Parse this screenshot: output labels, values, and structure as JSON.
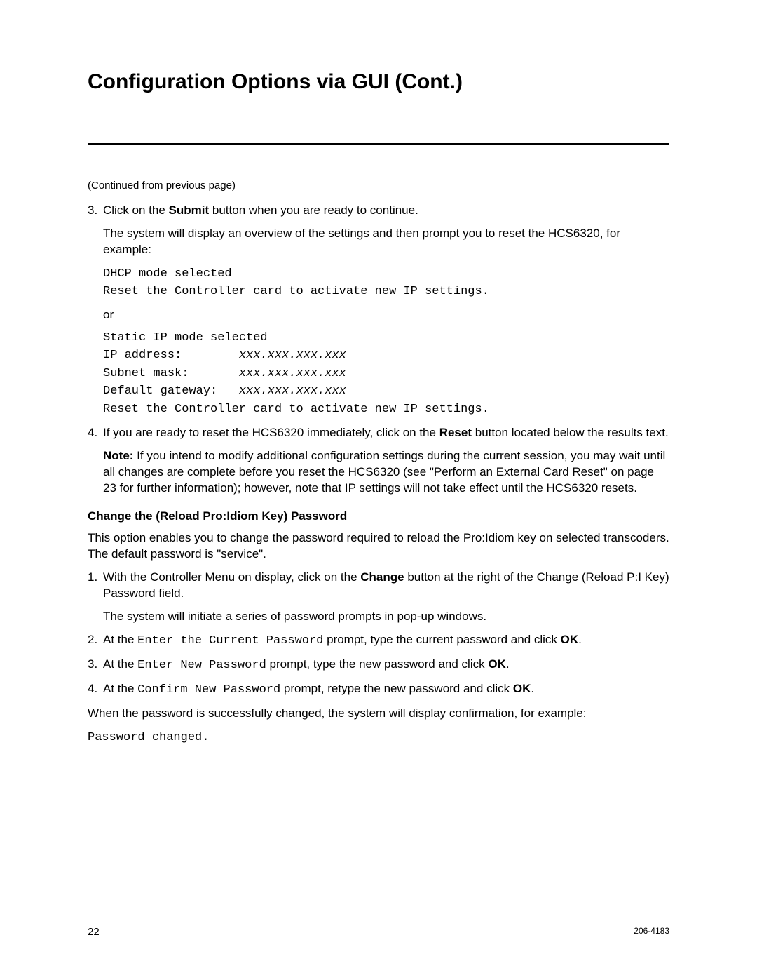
{
  "title": "Configuration Options via GUI (Cont.)",
  "continued": "(Continued from previous page)",
  "step3_num": "3.",
  "step3_a": "Click on the ",
  "step3_b": "Submit",
  "step3_c": " button when you are ready to continue.",
  "step3_desc": "The system will display an overview of the settings and then prompt you to reset the HCS6320, for example:",
  "dhcp_line1": "DHCP mode selected",
  "dhcp_line2": "Reset the Controller card to activate new IP settings.",
  "or": "or",
  "static_line1": "Static IP mode selected",
  "static_ip_lbl": "IP address:        ",
  "static_ip_val": "xxx.xxx.xxx.xxx",
  "static_sm_lbl": "Subnet mask:       ",
  "static_sm_val": "xxx.xxx.xxx.xxx",
  "static_gw_lbl": "Default gateway:   ",
  "static_gw_val": "xxx.xxx.xxx.xxx",
  "static_line5": "Reset the Controller card to activate new IP settings.",
  "step4_num": "4.",
  "step4_a": "If you are ready to reset the HCS6320 immediately, click on the ",
  "step4_b": "Reset",
  "step4_c": " button located below the results text.",
  "note_lbl": "Note:",
  "note_txt": " If you intend to modify additional configuration settings during the current session, you may wait until all changes are complete before you reset the HCS6320 (see \"Perform an External Card Reset\" on page 23 for further information); however, note that IP settings will not take effect until the HCS6320 resets.",
  "subhead": "Change the (Reload Pro:Idiom Key) Password",
  "pw_intro": "This option enables you to change the password required to reload the Pro:Idiom key on selected transcoders. The default password is \"service\".",
  "pw1_num": "1.",
  "pw1_a": "With the Controller Menu on display, click on the ",
  "pw1_b": "Change",
  "pw1_c": " button at the right of the Change (Reload P:I Key) Password field.",
  "pw1_desc": "The system will initiate a series of password prompts in pop-up windows.",
  "pw2_num": "2.",
  "pw2_a": "At the ",
  "pw2_b": "Enter the Current Password",
  "pw2_c": " prompt, type the current password and click ",
  "pw2_d": "OK",
  "pw2_e": ".",
  "pw3_num": "3.",
  "pw3_a": "At the ",
  "pw3_b": "Enter New Password",
  "pw3_c": " prompt, type the new password and click ",
  "pw3_d": "OK",
  "pw3_e": ".",
  "pw4_num": "4.",
  "pw4_a": "At the ",
  "pw4_b": "Confirm New Password",
  "pw4_c": " prompt, retype the new password and click ",
  "pw4_d": "OK",
  "pw4_e": ".",
  "pw_success": "When the password is successfully changed, the system will display confirmation, for example:",
  "pw_changed": "Password changed.",
  "page_num": "22",
  "doc_num": "206-4183"
}
